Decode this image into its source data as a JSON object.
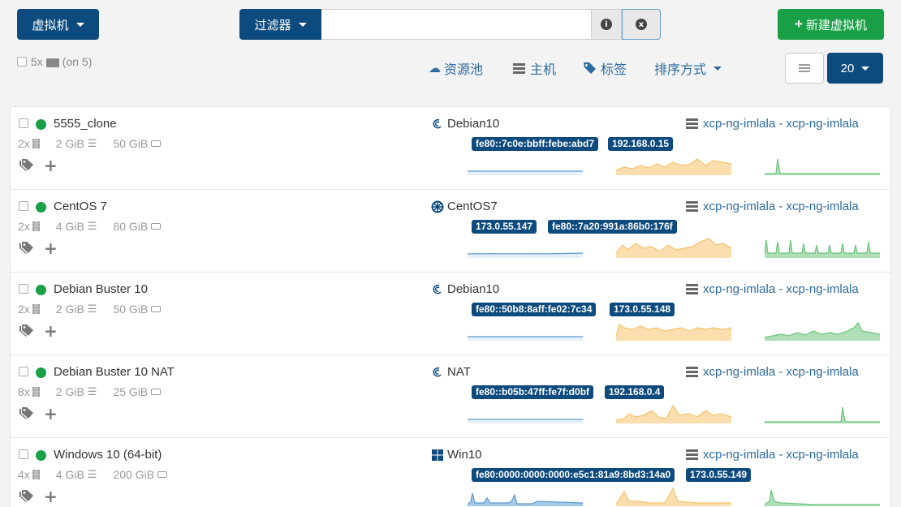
{
  "header": {
    "vm_menu_label": "虚拟机",
    "filter_label": "过滤器",
    "filter_value": "",
    "info_glyph": "i",
    "clear_glyph": "x",
    "new_vm_label": "新建虚拟机",
    "select_summary": "5x",
    "on_count": "(on 5)"
  },
  "toolbar": {
    "pools_label": "资源池",
    "hosts_label": "主机",
    "tags_label": "标签",
    "sort_label": "排序方式",
    "page_size": "20"
  },
  "colors": {
    "primary": "#0d4a7e",
    "success": "#19a047",
    "link": "#2c6aa0",
    "cpu_chart": "#5b9bd5",
    "mem_chart": "#f5c26b",
    "net_chart": "#6bc47a"
  },
  "vms": [
    {
      "name": "5555_clone",
      "cpus": "2x",
      "memory": "2 GiB",
      "disk": "50 GiB",
      "os": "Debian10",
      "os_icon": "debian-icon",
      "host": "xcp-ng-imlala - xcp-ng-imlala",
      "ips": [
        "fe80::7c0e:bbff:febe:abd7",
        "192.168.0.15"
      ]
    },
    {
      "name": "CentOS 7",
      "cpus": "2x",
      "memory": "4 GiB",
      "disk": "80 GiB",
      "os": "CentOS7",
      "os_icon": "centos-icon",
      "host": "xcp-ng-imlala - xcp-ng-imlala",
      "ips": [
        "173.0.55.147",
        "fe80::7a20:991a:86b0:176f"
      ]
    },
    {
      "name": "Debian Buster 10",
      "cpus": "2x",
      "memory": "2 GiB",
      "disk": "50 GiB",
      "os": "Debian10",
      "os_icon": "debian-icon",
      "host": "xcp-ng-imlala - xcp-ng-imlala",
      "ips": [
        "fe80::50b8:8aff:fe02:7c34",
        "173.0.55.148"
      ]
    },
    {
      "name": "Debian Buster 10 NAT",
      "cpus": "8x",
      "memory": "2 GiB",
      "disk": "25 GiB",
      "os": "NAT",
      "os_icon": "debian-icon",
      "host": "xcp-ng-imlala - xcp-ng-imlala",
      "ips": [
        "fe80::b05b:47ff:fe7f:d0bf",
        "192.168.0.4"
      ]
    },
    {
      "name": "Windows 10 (64-bit)",
      "cpus": "4x",
      "memory": "4 GiB",
      "disk": "200 GiB",
      "os": "Win10",
      "os_icon": "windows-icon",
      "host": "xcp-ng-imlala - xcp-ng-imlala",
      "ips": [
        "fe80:0000:0000:0000:e5c1:81a9:8bd3:14a0",
        "173.0.55.149"
      ]
    }
  ]
}
